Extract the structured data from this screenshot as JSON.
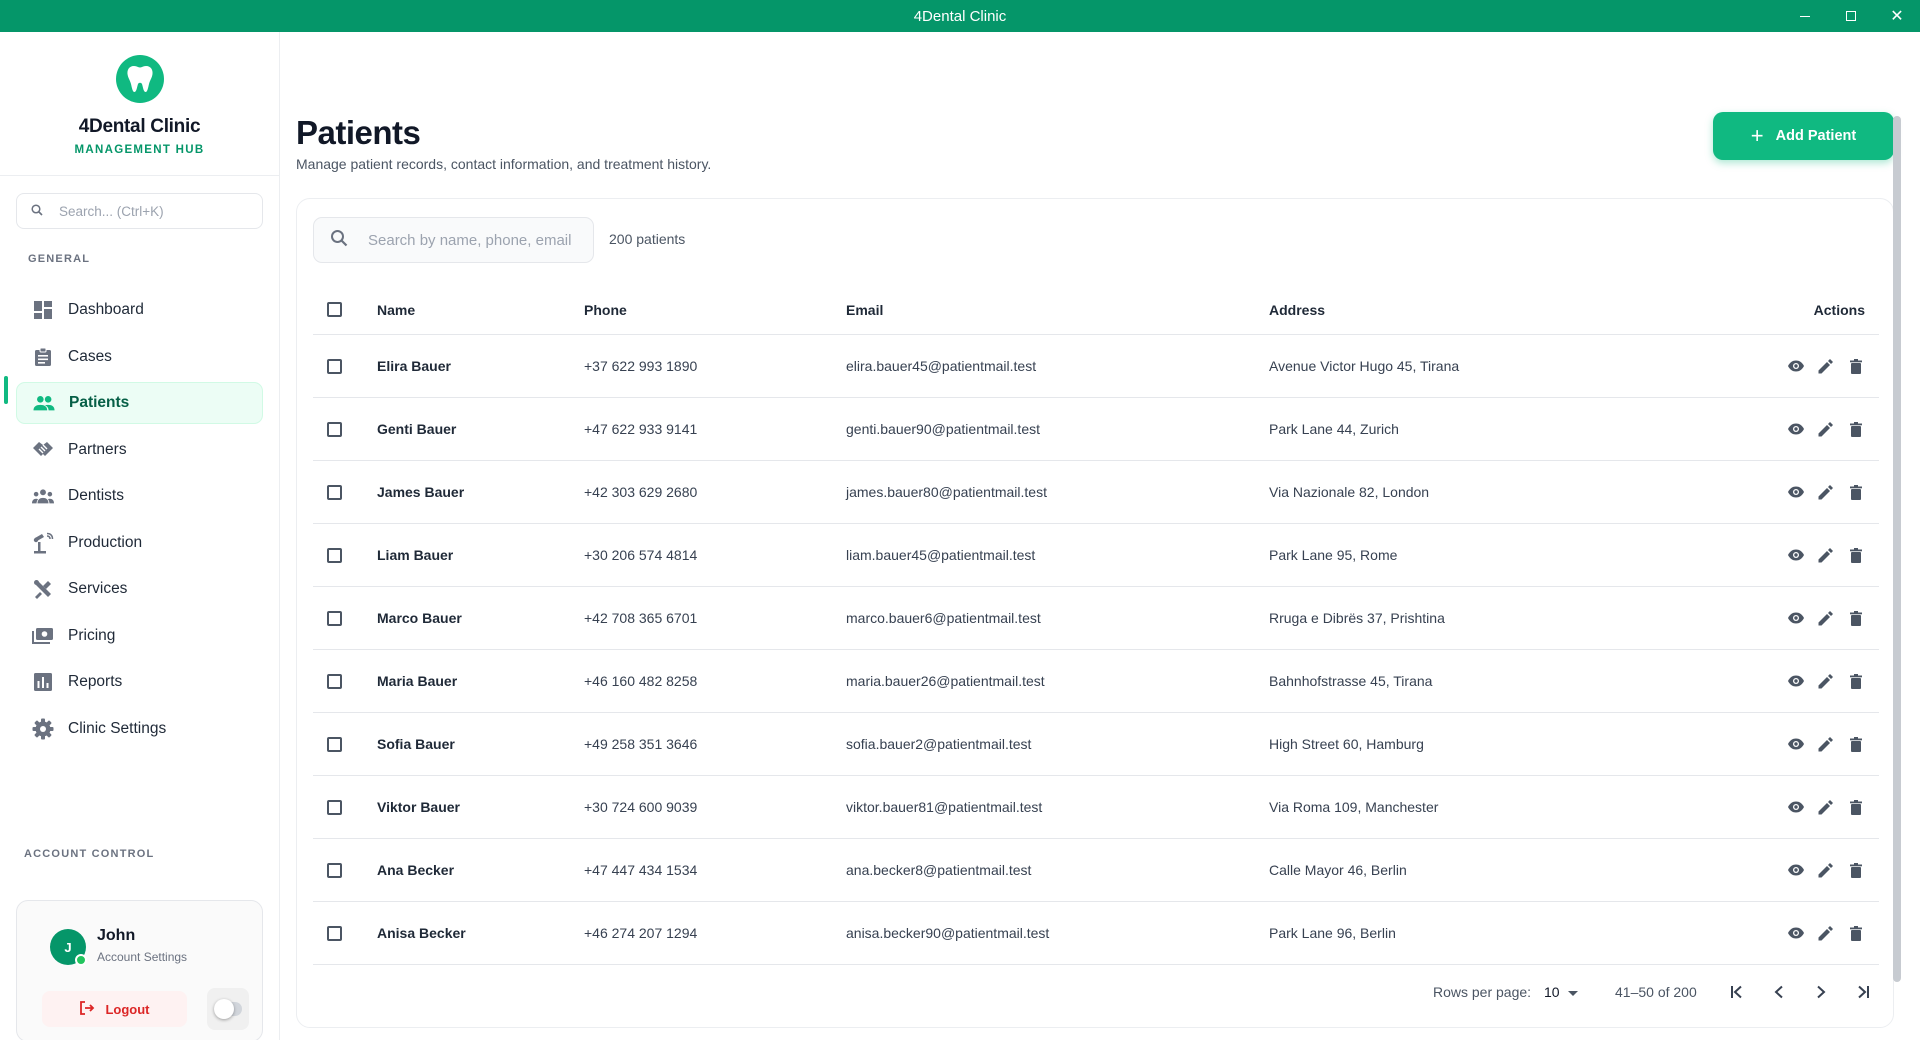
{
  "window": {
    "title": "4Dental Clinic"
  },
  "brand": {
    "name": "4Dental Clinic",
    "subtitle": "MANAGEMENT HUB"
  },
  "sidebar": {
    "search_placeholder": "Search... (Ctrl+K)",
    "section_general": "GENERAL",
    "items": [
      {
        "label": "Dashboard",
        "icon": "dashboard-icon",
        "active": false
      },
      {
        "label": "Cases",
        "icon": "clipboard-icon",
        "active": false
      },
      {
        "label": "Patients",
        "icon": "people-icon",
        "active": true
      },
      {
        "label": "Partners",
        "icon": "handshake-icon",
        "active": false
      },
      {
        "label": "Dentists",
        "icon": "groups-icon",
        "active": false
      },
      {
        "label": "Production",
        "icon": "precision-icon",
        "active": false
      },
      {
        "label": "Services",
        "icon": "tools-icon",
        "active": false
      },
      {
        "label": "Pricing",
        "icon": "payments-icon",
        "active": false
      },
      {
        "label": "Reports",
        "icon": "bar-chart-icon",
        "active": false
      },
      {
        "label": "Clinic Settings",
        "icon": "gear-icon",
        "active": false
      }
    ],
    "section_account": "ACCOUNT CONTROL",
    "account": {
      "initial": "J",
      "name": "John",
      "subtitle": "Account Settings",
      "logout_label": "Logout"
    }
  },
  "main": {
    "title": "Patients",
    "subtitle": "Manage patient records, contact information, and treatment history.",
    "add_button": "Add Patient",
    "search_placeholder": "Search by name, phone, email",
    "count_text": "200 patients",
    "columns": {
      "name": "Name",
      "phone": "Phone",
      "email": "Email",
      "address": "Address",
      "actions": "Actions"
    },
    "rows": [
      {
        "name": "Elira Bauer",
        "phone": "+37 622 993 1890",
        "email": "elira.bauer45@patientmail.test",
        "address": "Avenue Victor Hugo 45, Tirana"
      },
      {
        "name": "Genti Bauer",
        "phone": "+47 622 933 9141",
        "email": "genti.bauer90@patientmail.test",
        "address": "Park Lane 44, Zurich"
      },
      {
        "name": "James Bauer",
        "phone": "+42 303 629 2680",
        "email": "james.bauer80@patientmail.test",
        "address": "Via Nazionale 82, London"
      },
      {
        "name": "Liam Bauer",
        "phone": "+30 206 574 4814",
        "email": "liam.bauer45@patientmail.test",
        "address": "Park Lane 95, Rome"
      },
      {
        "name": "Marco Bauer",
        "phone": "+42 708 365 6701",
        "email": "marco.bauer6@patientmail.test",
        "address": "Rruga e Dibrës 37, Prishtina"
      },
      {
        "name": "Maria Bauer",
        "phone": "+46 160 482 8258",
        "email": "maria.bauer26@patientmail.test",
        "address": "Bahnhofstrasse 45, Tirana"
      },
      {
        "name": "Sofia Bauer",
        "phone": "+49 258 351 3646",
        "email": "sofia.bauer2@patientmail.test",
        "address": "High Street 60, Hamburg"
      },
      {
        "name": "Viktor Bauer",
        "phone": "+30 724 600 9039",
        "email": "viktor.bauer81@patientmail.test",
        "address": "Via Roma 109, Manchester"
      },
      {
        "name": "Ana Becker",
        "phone": "+47 447 434 1534",
        "email": "ana.becker8@patientmail.test",
        "address": "Calle Mayor 46, Berlin"
      },
      {
        "name": "Anisa Becker",
        "phone": "+46 274 207 1294",
        "email": "anisa.becker90@patientmail.test",
        "address": "Park Lane 96, Berlin"
      }
    ],
    "pagination": {
      "rows_per_page_label": "Rows per page:",
      "rows_per_page_value": "10",
      "range_text": "41–50 of 200"
    }
  },
  "colors": {
    "accent": "#10b981",
    "titlebar": "#059669",
    "danger": "#dc2626"
  }
}
